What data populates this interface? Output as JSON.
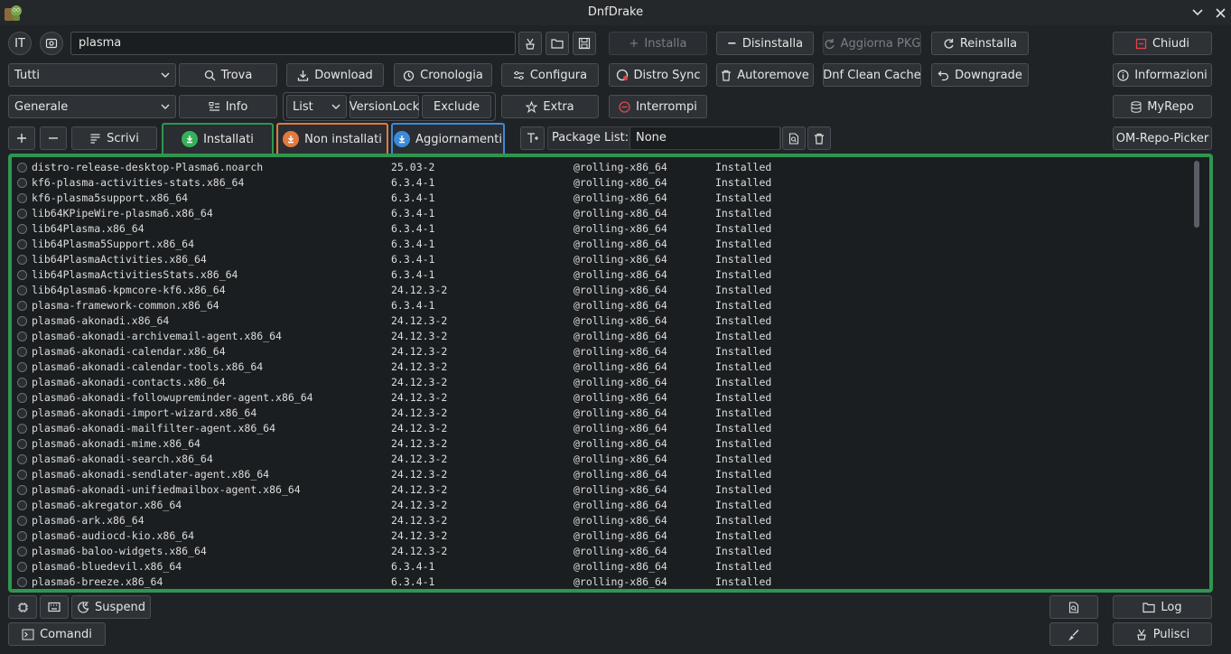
{
  "window": {
    "title": "DnfDrake"
  },
  "colors": {
    "installed": "#2e9650",
    "not_installed": "#e07a3f",
    "updates": "#3d8ad8",
    "danger": "#e0444f"
  },
  "toolbar1": {
    "lang": "IT",
    "search_value": "plasma",
    "install": "Installa",
    "uninstall": "Disinstalla",
    "update_pkg": "Aggiorna PKG",
    "reinstall": "Reinstalla",
    "close": "Chiudi"
  },
  "toolbar2": {
    "filter_select": "Tutti",
    "find": "Trova",
    "download": "Download",
    "history": "Cronologia",
    "configure": "Configura",
    "distro_sync": "Distro Sync",
    "autoremove": "Autoremove",
    "clean_cache": "Dnf Clean Cache",
    "downgrade": "Downgrade",
    "info_app": "Informazioni"
  },
  "toolbar3": {
    "group_select": "Generale",
    "info": "Info",
    "mode_select": "List",
    "versionlock": "VersionLock",
    "exclude": "Exclude",
    "extra": "Extra",
    "interrupt": "Interrompi",
    "myrepo": "MyRepo"
  },
  "toolbar4": {
    "write": "Scrivi",
    "tab_installed": "Installati",
    "tab_not_installed": "Non installati",
    "tab_updates": "Aggiornamenti",
    "package_list_label": "Package List:",
    "package_list_value": "None",
    "om_repo_picker": "OM-Repo-Picker"
  },
  "packages": [
    [
      "distro-release-desktop-Plasma6.noarch",
      "25.03-2",
      "@rolling-x86_64",
      "Installed"
    ],
    [
      "kf6-plasma-activities-stats.x86_64",
      "6.3.4-1",
      "@rolling-x86_64",
      "Installed"
    ],
    [
      "kf6-plasma5support.x86_64",
      "6.3.4-1",
      "@rolling-x86_64",
      "Installed"
    ],
    [
      "lib64KPipeWire-plasma6.x86_64",
      "6.3.4-1",
      "@rolling-x86_64",
      "Installed"
    ],
    [
      "lib64Plasma.x86_64",
      "6.3.4-1",
      "@rolling-x86_64",
      "Installed"
    ],
    [
      "lib64Plasma5Support.x86_64",
      "6.3.4-1",
      "@rolling-x86_64",
      "Installed"
    ],
    [
      "lib64PlasmaActivities.x86_64",
      "6.3.4-1",
      "@rolling-x86_64",
      "Installed"
    ],
    [
      "lib64PlasmaActivitiesStats.x86_64",
      "6.3.4-1",
      "@rolling-x86_64",
      "Installed"
    ],
    [
      "lib64plasma6-kpmcore-kf6.x86_64",
      "24.12.3-2",
      "@rolling-x86_64",
      "Installed"
    ],
    [
      "plasma-framework-common.x86_64",
      "6.3.4-1",
      "@rolling-x86_64",
      "Installed"
    ],
    [
      "plasma6-akonadi.x86_64",
      "24.12.3-2",
      "@rolling-x86_64",
      "Installed"
    ],
    [
      "plasma6-akonadi-archivemail-agent.x86_64",
      "24.12.3-2",
      "@rolling-x86_64",
      "Installed"
    ],
    [
      "plasma6-akonadi-calendar.x86_64",
      "24.12.3-2",
      "@rolling-x86_64",
      "Installed"
    ],
    [
      "plasma6-akonadi-calendar-tools.x86_64",
      "24.12.3-2",
      "@rolling-x86_64",
      "Installed"
    ],
    [
      "plasma6-akonadi-contacts.x86_64",
      "24.12.3-2",
      "@rolling-x86_64",
      "Installed"
    ],
    [
      "plasma6-akonadi-followupreminder-agent.x86_64",
      "24.12.3-2",
      "@rolling-x86_64",
      "Installed"
    ],
    [
      "plasma6-akonadi-import-wizard.x86_64",
      "24.12.3-2",
      "@rolling-x86_64",
      "Installed"
    ],
    [
      "plasma6-akonadi-mailfilter-agent.x86_64",
      "24.12.3-2",
      "@rolling-x86_64",
      "Installed"
    ],
    [
      "plasma6-akonadi-mime.x86_64",
      "24.12.3-2",
      "@rolling-x86_64",
      "Installed"
    ],
    [
      "plasma6-akonadi-search.x86_64",
      "24.12.3-2",
      "@rolling-x86_64",
      "Installed"
    ],
    [
      "plasma6-akonadi-sendlater-agent.x86_64",
      "24.12.3-2",
      "@rolling-x86_64",
      "Installed"
    ],
    [
      "plasma6-akonadi-unifiedmailbox-agent.x86_64",
      "24.12.3-2",
      "@rolling-x86_64",
      "Installed"
    ],
    [
      "plasma6-akregator.x86_64",
      "24.12.3-2",
      "@rolling-x86_64",
      "Installed"
    ],
    [
      "plasma6-ark.x86_64",
      "24.12.3-2",
      "@rolling-x86_64",
      "Installed"
    ],
    [
      "plasma6-audiocd-kio.x86_64",
      "24.12.3-2",
      "@rolling-x86_64",
      "Installed"
    ],
    [
      "plasma6-baloo-widgets.x86_64",
      "24.12.3-2",
      "@rolling-x86_64",
      "Installed"
    ],
    [
      "plasma6-bluedevil.x86_64",
      "6.3.4-1",
      "@rolling-x86_64",
      "Installed"
    ],
    [
      "plasma6-breeze.x86_64",
      "6.3.4-1",
      "@rolling-x86_64",
      "Installed"
    ]
  ],
  "bottom": {
    "suspend": "Suspend",
    "commands": "Comandi",
    "log": "Log",
    "clean": "Pulisci"
  }
}
